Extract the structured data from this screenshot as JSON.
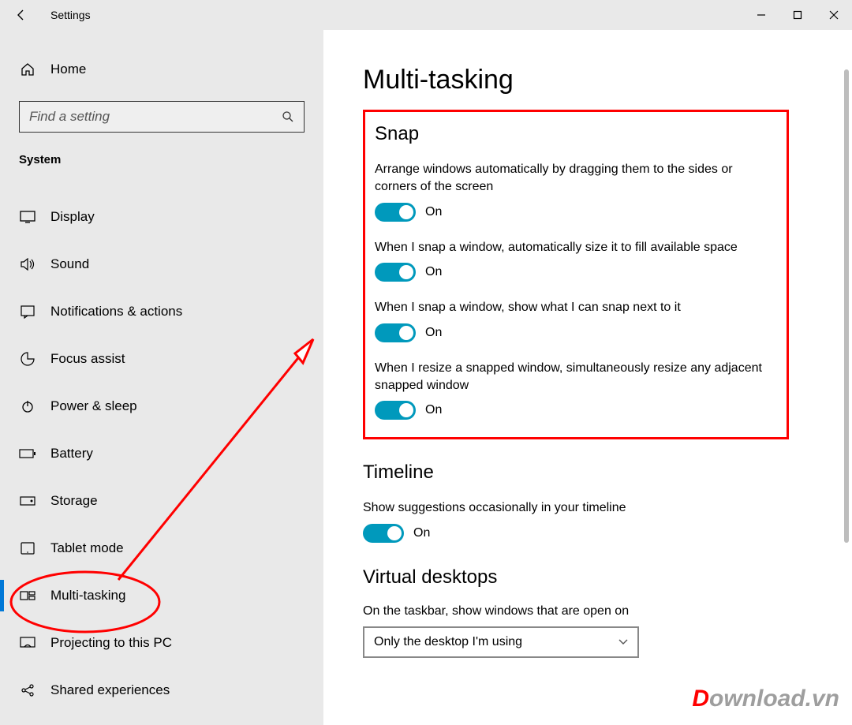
{
  "app_title": "Settings",
  "home_label": "Home",
  "search_placeholder": "Find a setting",
  "section_label": "System",
  "nav": [
    {
      "id": "display",
      "label": "Display"
    },
    {
      "id": "sound",
      "label": "Sound"
    },
    {
      "id": "notifications",
      "label": "Notifications & actions"
    },
    {
      "id": "focus-assist",
      "label": "Focus assist"
    },
    {
      "id": "power-sleep",
      "label": "Power & sleep"
    },
    {
      "id": "battery",
      "label": "Battery"
    },
    {
      "id": "storage",
      "label": "Storage"
    },
    {
      "id": "tablet-mode",
      "label": "Tablet mode"
    },
    {
      "id": "multi-tasking",
      "label": "Multi-tasking",
      "active": true
    },
    {
      "id": "projecting",
      "label": "Projecting to this PC"
    },
    {
      "id": "shared-exp",
      "label": "Shared experiences"
    }
  ],
  "page_title": "Multi-tasking",
  "snap": {
    "heading": "Snap",
    "items": [
      {
        "desc": "Arrange windows automatically by dragging them to the sides or corners of the screen",
        "state_label": "On",
        "on": true
      },
      {
        "desc": "When I snap a window, automatically size it to fill available space",
        "state_label": "On",
        "on": true
      },
      {
        "desc": "When I snap a window, show what I can snap next to it",
        "state_label": "On",
        "on": true
      },
      {
        "desc": "When I resize a snapped window, simultaneously resize any adjacent snapped window",
        "state_label": "On",
        "on": true
      }
    ]
  },
  "timeline": {
    "heading": "Timeline",
    "item": {
      "desc": "Show suggestions occasionally in your timeline",
      "state_label": "On",
      "on": true
    }
  },
  "virtual_desktops": {
    "heading": "Virtual desktops",
    "label": "On the taskbar, show windows that are open on",
    "selected": "Only the desktop I'm using"
  },
  "watermark": {
    "d": "D",
    "rest": "ownload.vn"
  },
  "colors": {
    "accent": "#0078d7",
    "toggle_on": "#0099bc",
    "highlight_border": "#ff0000"
  }
}
